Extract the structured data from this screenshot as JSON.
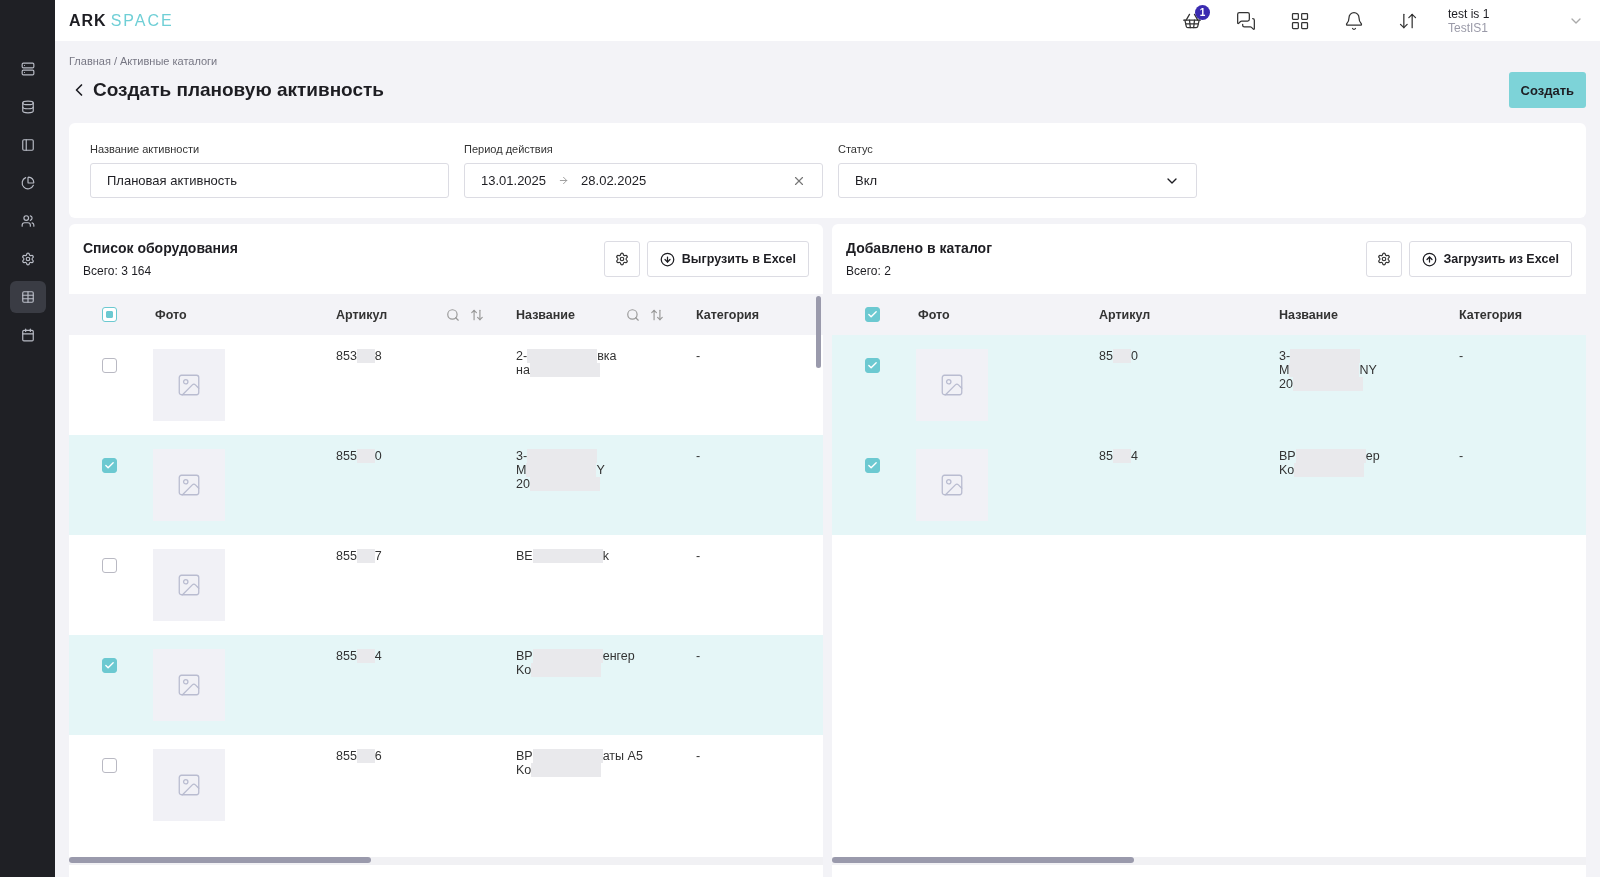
{
  "logo": {
    "dark": "ARK",
    "light": "SPACE"
  },
  "topbar": {
    "cart_badge": "1",
    "user_name": "test is 1",
    "user_org": "TestIS1"
  },
  "sidebar": {
    "items": [
      {
        "selected": false
      },
      {
        "selected": false
      },
      {
        "selected": false
      },
      {
        "selected": false
      },
      {
        "selected": false
      },
      {
        "selected": false
      },
      {
        "selected": true
      },
      {
        "selected": false
      }
    ]
  },
  "breadcrumb": "Главная / Активные каталоги",
  "title": "Создать плановую активность",
  "create_button": "Создать",
  "form": {
    "name_label": "Название активности",
    "name_value": "Плановая активность",
    "period_label": "Период действия",
    "date_from": "13.01.2025",
    "date_to": "28.02.2025",
    "status_label": "Статус",
    "status_value": "Вкл"
  },
  "panels": [
    {
      "title": "Список оборудования",
      "total": "Всего: 3 164",
      "action": "Выгрузить в Excel",
      "kind": "download",
      "header_checked": false,
      "header_indeterminate": true,
      "columns": [
        {
          "label": "Фото",
          "tools": false
        },
        {
          "label": "Артикул",
          "tools": true
        },
        {
          "label": "Название",
          "tools": true
        },
        {
          "label": "Категория",
          "tools": false
        }
      ],
      "rows": [
        {
          "checked": false,
          "article": {
            "before": "853",
            "after": "8"
          },
          "name": [
            {
              "before": "2-",
              "after": "вка"
            },
            {
              "before": "на"
            }
          ],
          "category": "-"
        },
        {
          "checked": true,
          "article": {
            "before": "855",
            "after": "0"
          },
          "name": [
            {
              "before": "3-"
            },
            {
              "before": "M",
              "after": "Y"
            },
            {
              "before": "20"
            }
          ],
          "category": "-"
        },
        {
          "checked": false,
          "article": {
            "before": "855",
            "after": "7"
          },
          "name": [
            {
              "before": "BE",
              "after": "k"
            }
          ],
          "category": "-"
        },
        {
          "checked": true,
          "article": {
            "before": "855",
            "after": "4"
          },
          "name": [
            {
              "before": "BP",
              "after": "енгер"
            },
            {
              "before": "Ko"
            }
          ],
          "category": "-"
        },
        {
          "checked": false,
          "article": {
            "before": "855",
            "after": "6"
          },
          "name": [
            {
              "before": "BP",
              "after": "аты A5"
            },
            {
              "before": "Ko"
            }
          ],
          "category": "-"
        }
      ]
    },
    {
      "title": "Добавлено в каталог",
      "total": "Всего: 2",
      "action": "Загрузить из Excel",
      "kind": "upload",
      "header_checked": true,
      "header_indeterminate": false,
      "columns": [
        {
          "label": "Фото",
          "tools": false
        },
        {
          "label": "Артикул",
          "tools": false
        },
        {
          "label": "Название",
          "tools": false
        },
        {
          "label": "Категория",
          "tools": false
        }
      ],
      "rows": [
        {
          "checked": true,
          "article": {
            "before": "85",
            "after": "0"
          },
          "name": [
            {
              "before": "3-"
            },
            {
              "before": "M",
              "after": "NY"
            },
            {
              "before": "20"
            }
          ],
          "category": "-"
        },
        {
          "checked": true,
          "article": {
            "before": "85",
            "after": "4"
          },
          "name": [
            {
              "before": "BP",
              "after": "ер"
            },
            {
              "before": "Ko"
            }
          ],
          "category": "-"
        }
      ]
    }
  ]
}
